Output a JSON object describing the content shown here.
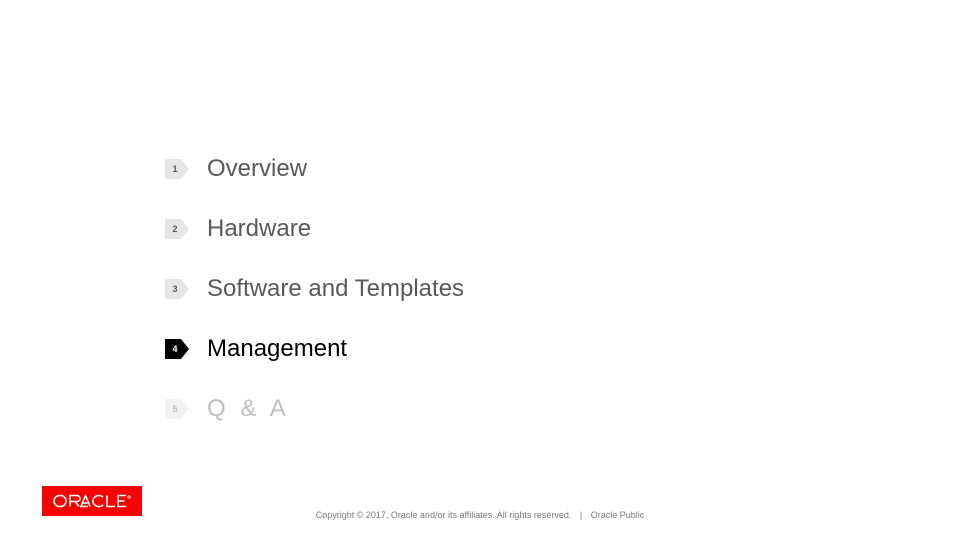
{
  "agenda": {
    "items": [
      {
        "num": "1",
        "label": "Overview",
        "active": false,
        "faded": false
      },
      {
        "num": "2",
        "label": "Hardware",
        "active": false,
        "faded": false
      },
      {
        "num": "3",
        "label": "Software and Templates",
        "active": false,
        "faded": false
      },
      {
        "num": "4",
        "label": "Management",
        "active": true,
        "faded": false
      },
      {
        "num": "5",
        "label": "Q & A",
        "active": false,
        "faded": true
      }
    ]
  },
  "brand": {
    "name": "ORACLE",
    "color": "#f80000"
  },
  "footer": {
    "copyright": "Copyright © 2017, Oracle and/or its affiliates. All rights reserved.",
    "separator": "|",
    "classification": "Oracle Public"
  }
}
